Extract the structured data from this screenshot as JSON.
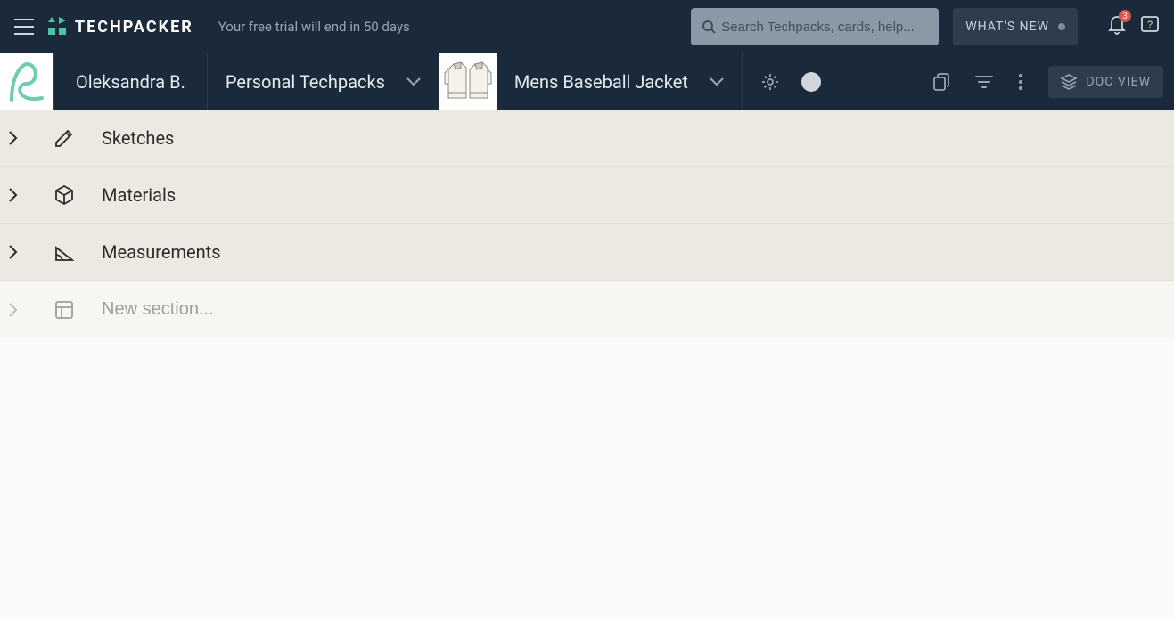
{
  "header": {
    "brand": "TECHPACKER",
    "trial_message": "Your free trial will end in 50 days",
    "search_placeholder": "Search Techpacks, cards, help...",
    "whats_new": "WHAT'S NEW",
    "notification_count": "3"
  },
  "subheader": {
    "user_name": "Oleksandra B.",
    "collection": "Personal Techpacks",
    "product_name": "Mens Baseball Jacket",
    "doc_view_label": "DOC VIEW"
  },
  "sections": [
    {
      "title": "Sketches"
    },
    {
      "title": "Materials"
    },
    {
      "title": "Measurements"
    }
  ],
  "new_section_placeholder": "New section...",
  "colors": {
    "header_bg": "#1b2a3a",
    "accent": "#4fc3a1",
    "section_bg": "#ebe9e1",
    "badge": "#d9534f"
  }
}
